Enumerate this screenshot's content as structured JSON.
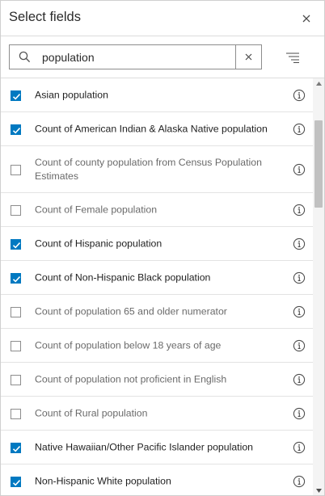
{
  "dialog": {
    "title": "Select fields"
  },
  "icons": {
    "close": "close-icon",
    "search": "search-icon",
    "clear": "clear-icon",
    "sort": "sort-filter-icon",
    "info": "info-icon"
  },
  "colors": {
    "accent": "#0079c1"
  },
  "search": {
    "value": "population",
    "placeholder": ""
  },
  "fields": [
    {
      "label": "Asian population",
      "checked": true
    },
    {
      "label": "Count of American Indian & Alaska Native population",
      "checked": true
    },
    {
      "label": "Count of county population from Census Population Estimates",
      "checked": false
    },
    {
      "label": "Count of Female population",
      "checked": false
    },
    {
      "label": "Count of Hispanic population",
      "checked": true
    },
    {
      "label": "Count of Non-Hispanic Black population",
      "checked": true
    },
    {
      "label": "Count of population 65 and older numerator",
      "checked": false
    },
    {
      "label": "Count of population below 18 years of age",
      "checked": false
    },
    {
      "label": "Count of population not proficient in English",
      "checked": false
    },
    {
      "label": "Count of Rural population",
      "checked": false
    },
    {
      "label": "Native Hawaiian/Other Pacific Islander population",
      "checked": true
    },
    {
      "label": "Non-Hispanic White population",
      "checked": true
    }
  ]
}
